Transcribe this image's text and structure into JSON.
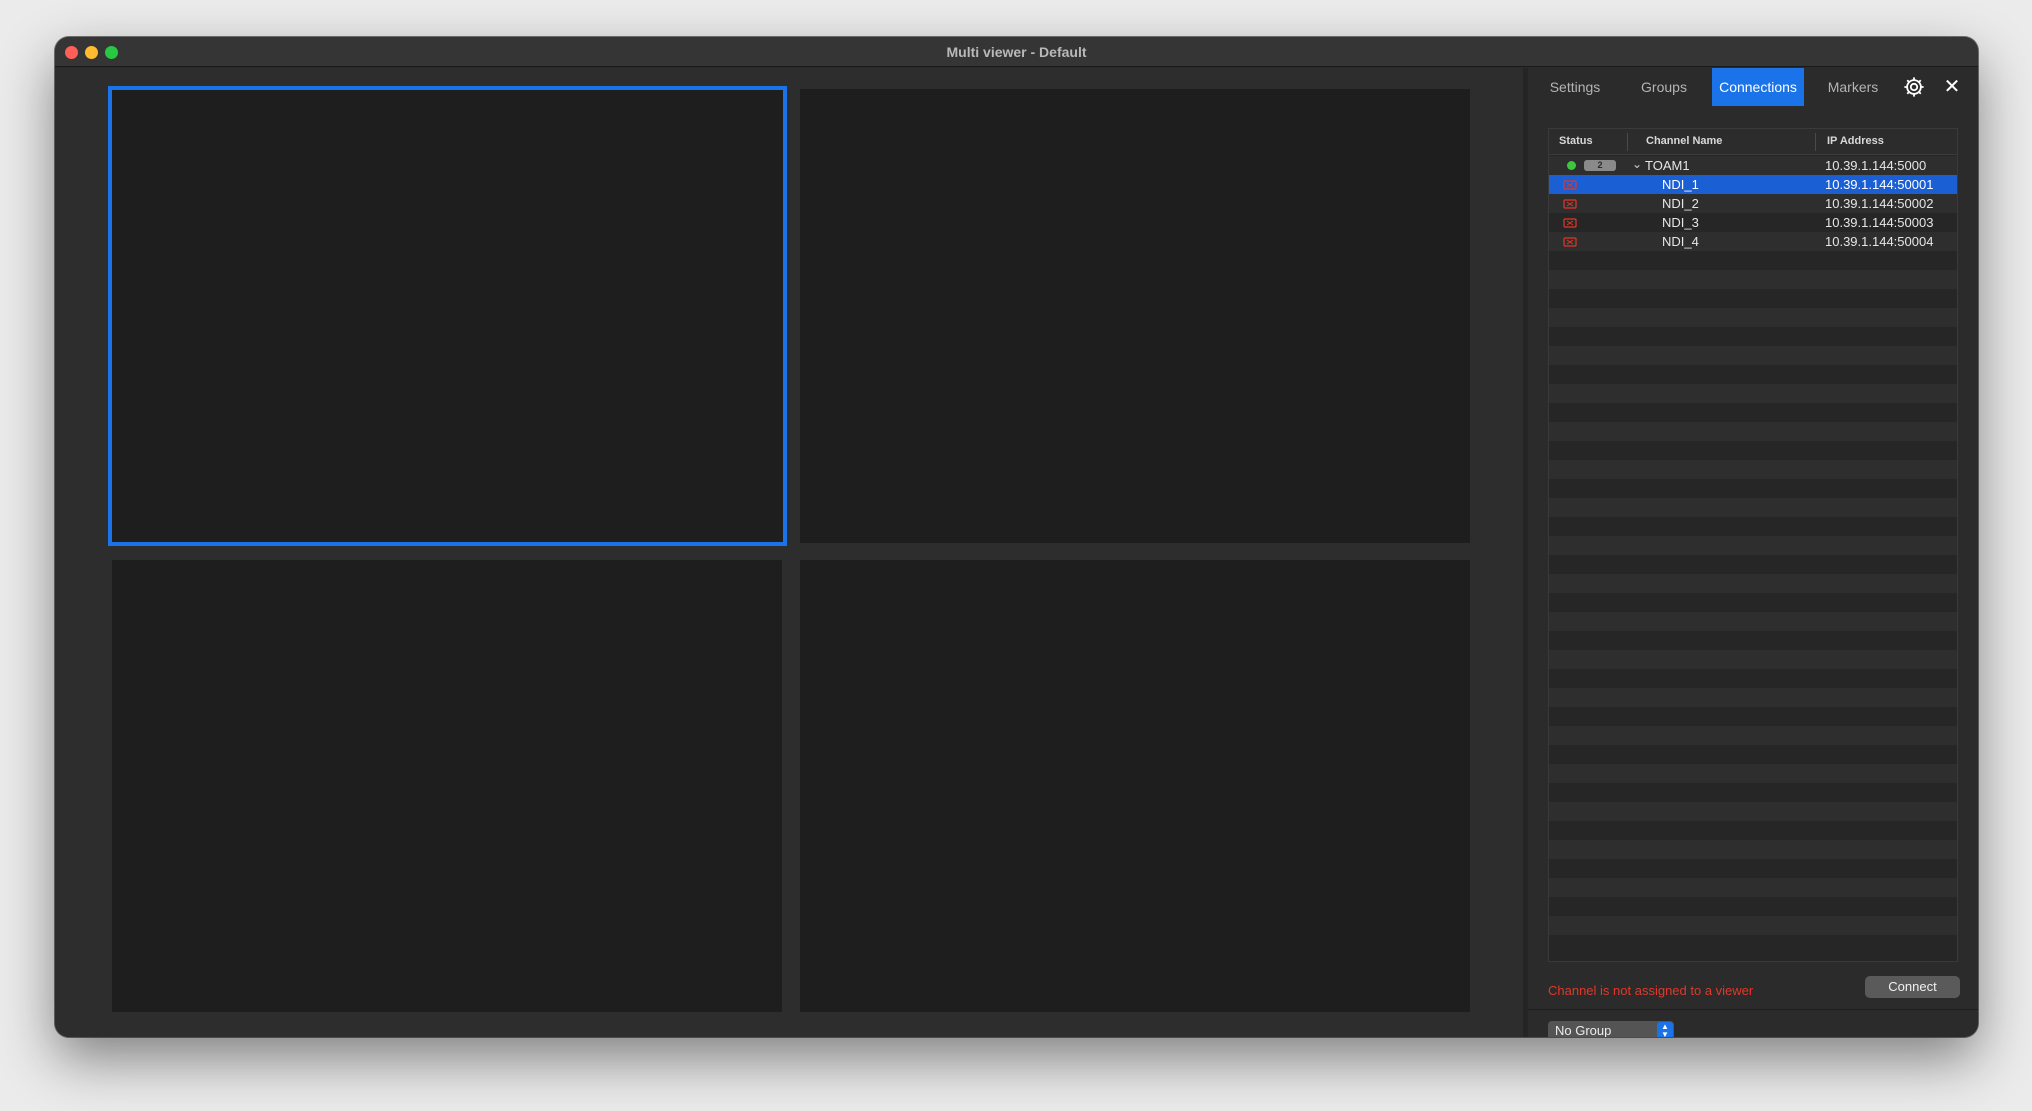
{
  "window": {
    "title": "Multi viewer - Default"
  },
  "tabs": [
    {
      "label": "Settings",
      "active": false
    },
    {
      "label": "Groups",
      "active": false
    },
    {
      "label": "Connections",
      "active": true
    },
    {
      "label": "Markers",
      "active": false
    }
  ],
  "icons": {
    "settings": "gear-icon",
    "close": "close-icon",
    "status_online": "green-dot-icon",
    "status_offline": "red-channel-icon"
  },
  "table": {
    "columns": [
      "Status",
      "Channel Name",
      "IP Address"
    ],
    "group_row": {
      "count": "2",
      "name": "TOAM1",
      "ip": "10.39.1.144:5000"
    },
    "channels": [
      {
        "name": "NDI_1",
        "ip": "10.39.1.144:50001",
        "selected": true
      },
      {
        "name": "NDI_2",
        "ip": "10.39.1.144:50002",
        "selected": false
      },
      {
        "name": "NDI_3",
        "ip": "10.39.1.144:50003",
        "selected": false
      },
      {
        "name": "NDI_4",
        "ip": "10.39.1.144:50004",
        "selected": false
      }
    ]
  },
  "footer": {
    "message": "Channel is not assigned to a viewer",
    "connect_label": "Connect",
    "group_select_value": "No Group"
  },
  "colors": {
    "accent": "#1a73e8",
    "error": "#e0382a",
    "online": "#3fc43f"
  }
}
